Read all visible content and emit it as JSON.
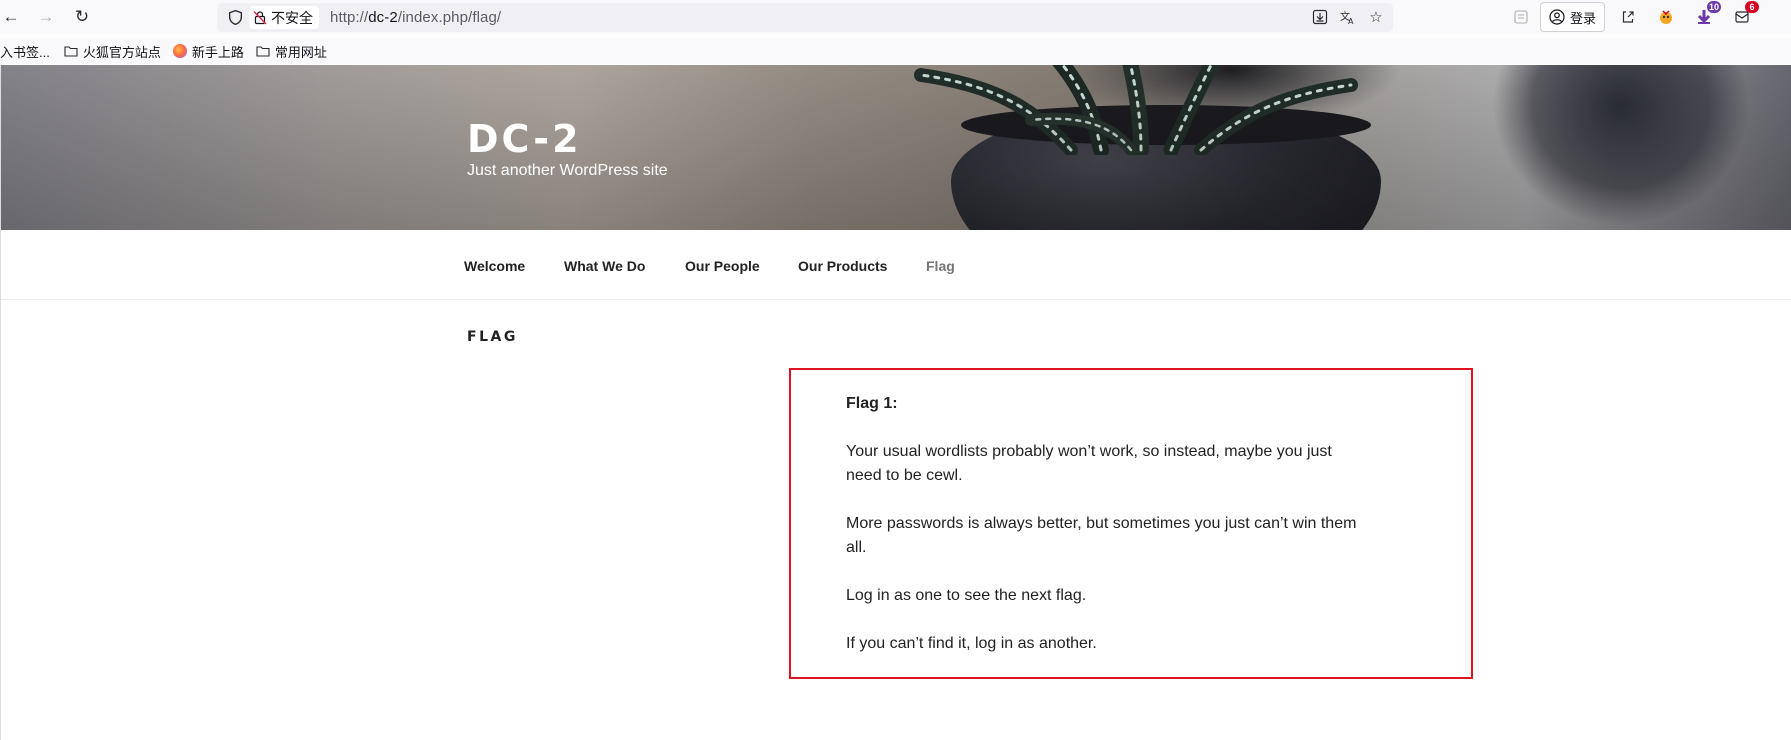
{
  "browser": {
    "url_security_label": "不安全",
    "url_prefix": "http://",
    "url_host": "dc-2",
    "url_path": "/index.php/flag/",
    "login_label": "登录",
    "badge_downloads": "10",
    "badge_messages": "6"
  },
  "bookmarks": [
    {
      "label": "入书签..."
    },
    {
      "label": "火狐官方站点"
    },
    {
      "label": "新手上路"
    },
    {
      "label": "常用网址"
    }
  ],
  "site": {
    "title": "DC-2",
    "description": "Just another WordPress site"
  },
  "nav": [
    {
      "label": "Welcome"
    },
    {
      "label": "What We Do"
    },
    {
      "label": "Our People"
    },
    {
      "label": "Our Products"
    },
    {
      "label": "Flag"
    }
  ],
  "entry": {
    "title": "FLAG",
    "heading": "Flag 1:",
    "paragraphs": [
      "Your usual wordlists probably won’t work, so instead, maybe you just need to be cewl.",
      "More passwords is always better, but sometimes you just can’t win them all.",
      "Log in as one to see the next flag.",
      "If you can’t find it, log in as another."
    ]
  },
  "colors": {
    "highlight_border": "#e0141e",
    "nav_current": "#767676"
  }
}
